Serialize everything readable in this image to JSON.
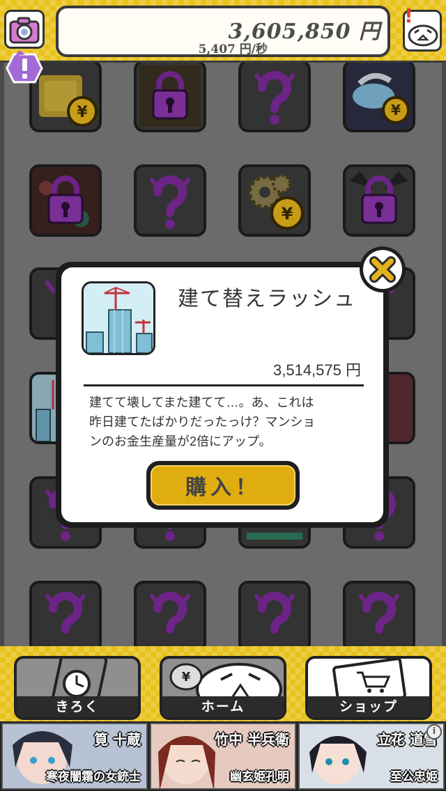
{
  "header": {
    "total_money": "3,605,850 円",
    "income_rate": "5,407 円/秒"
  },
  "dialog": {
    "item_name": "建て替えラッシュ",
    "price": "3,514,575 円",
    "description_lines": [
      "建てて壊してまた建てて…。あ、これは",
      "昨日建てたばかりだったっけ？マンショ",
      "ンのお金生産量が2倍にアップ。"
    ],
    "buy_label": "購入！"
  },
  "nav": {
    "items": [
      {
        "label": "きろく",
        "icon": "clock-phone-icon"
      },
      {
        "label": "ホーム",
        "icon": "mascot-money-icon"
      },
      {
        "label": "ショップ",
        "icon": "cart-laptop-icon"
      }
    ]
  },
  "banner": {
    "cards": [
      {
        "name": "筧 十蔵",
        "title": "寒夜闇霜の女銃士"
      },
      {
        "name": "竹中 半兵衛",
        "title": "幽玄姫孔明"
      },
      {
        "name": "立花 道雪",
        "title": "至公忠姫"
      }
    ],
    "info_label": "i"
  },
  "colors": {
    "accent_yellow": "#e8c21a",
    "buy_button": "#e0ad10",
    "locked_purple": "#7b2a9a",
    "coin_gold": "#e3b21c"
  }
}
